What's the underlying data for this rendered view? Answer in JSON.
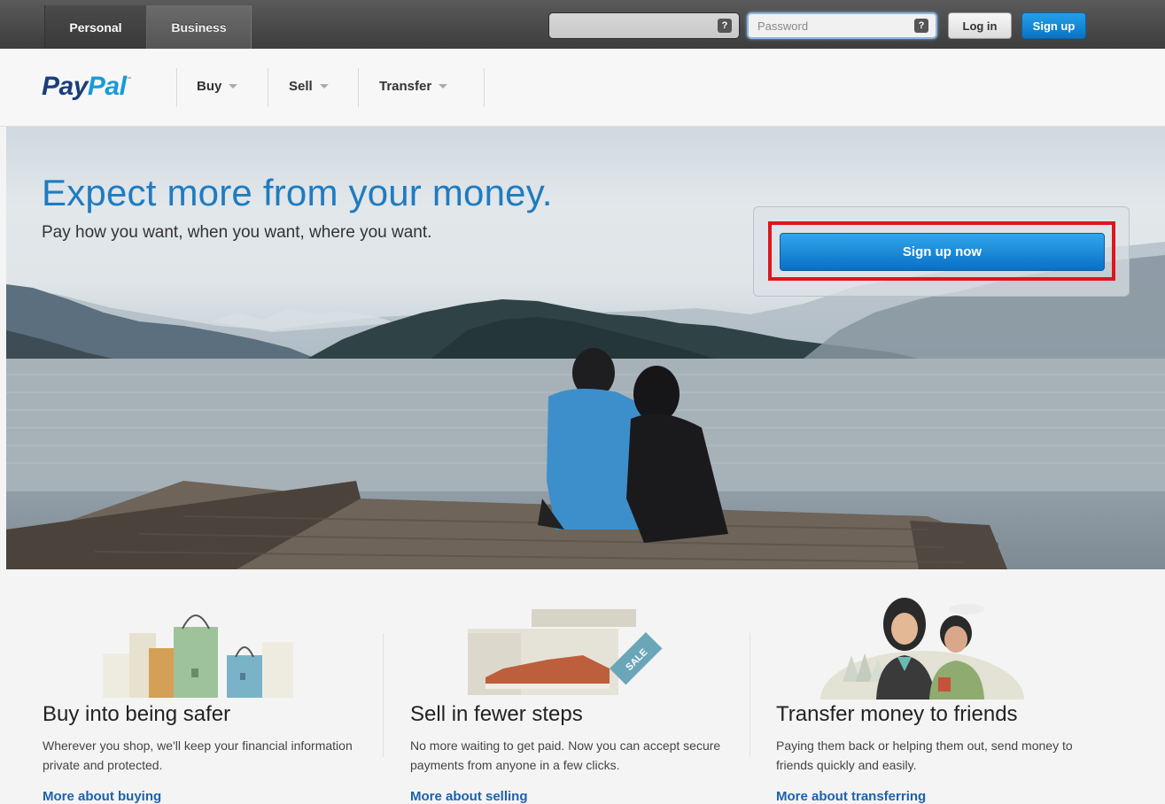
{
  "topbar": {
    "tabs": [
      {
        "label": "Personal",
        "active": true
      },
      {
        "label": "Business",
        "active": false
      }
    ],
    "email_placeholder": "",
    "password_placeholder": "Password",
    "help_icon_label": "?",
    "login_label": "Log in",
    "signup_label": "Sign up"
  },
  "nav": {
    "logo_pay": "Pay",
    "logo_pal": "Pal",
    "logo_tm": "™",
    "items": [
      {
        "label": "Buy"
      },
      {
        "label": "Sell"
      },
      {
        "label": "Transfer"
      }
    ]
  },
  "hero": {
    "title": "Expect more from your money.",
    "subtitle": "Pay how you want, when you want, where you want.",
    "cta_label": "Sign up now"
  },
  "features": [
    {
      "title": "Buy into being safer",
      "description": "Wherever you shop, we'll keep your financial information private and protected.",
      "link": "More about buying",
      "icon": "shopping-bags-icon"
    },
    {
      "title": "Sell in fewer steps",
      "description": "No more waiting to get paid. Now you can accept secure payments from anyone in a few clicks.",
      "link": "More about selling",
      "icon": "shoe-sale-tag-icon",
      "tag_text": "SALE"
    },
    {
      "title": "Transfer money to friends",
      "description": "Paying them back or helping them out, send money to friends quickly and easily.",
      "link": "More about transferring",
      "icon": "two-friends-icon"
    }
  ],
  "colors": {
    "brand_dark": "#1b3d7c",
    "brand_light": "#179bd7",
    "accent_blue": "#0b6fc4",
    "highlight_red": "#e0141d"
  }
}
